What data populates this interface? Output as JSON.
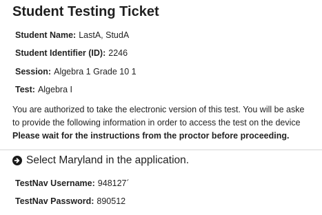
{
  "ticket": {
    "title": "Student Testing Ticket",
    "student_name_label": "Student Name:",
    "student_name_value": "LastA, StudA",
    "student_id_label": "Student Identifier (ID):",
    "student_id_value": "2246",
    "session_label": "Session:",
    "session_value": "Algebra 1 Grade 10 1",
    "test_label": "Test:",
    "test_value": "Algebra I",
    "instructions_line1": "You are authorized to take the electronic version of this test. You will be aske",
    "instructions_line2": "to provide the following information in order to access the test on the device",
    "instructions_bold": "Please wait for the instructions from the proctor before proceeding.",
    "select_text": "Select Maryland in the application.",
    "username_label": "TestNav Username:",
    "username_value": "948127´",
    "password_label": "TestNav Password:",
    "password_value": "890512"
  },
  "icons": {
    "select_arrow": "circle-arrow-right-icon"
  },
  "colors": {
    "text": "#222222",
    "divider": "#d6d6d6"
  }
}
